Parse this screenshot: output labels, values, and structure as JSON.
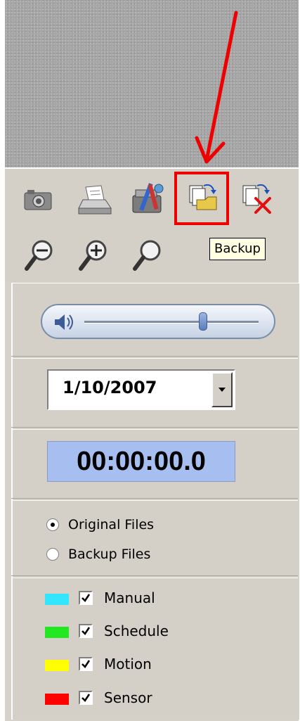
{
  "toolbar": {
    "row1": [
      {
        "name": "snapshot-camera-icon"
      },
      {
        "name": "print-icon"
      },
      {
        "name": "settings-tools-icon"
      },
      {
        "name": "backup-icon"
      },
      {
        "name": "delete-backup-icon"
      }
    ],
    "row2": [
      {
        "name": "zoom-out-icon"
      },
      {
        "name": "zoom-in-icon"
      },
      {
        "name": "zoom-reset-icon"
      }
    ],
    "tooltip": "Backup"
  },
  "playback": {
    "volume_level": 0.68,
    "date": "1/10/2007",
    "time": "00:00:00.0"
  },
  "source": {
    "options": [
      "Original Files",
      "Backup Files"
    ],
    "selected": "Original Files"
  },
  "legend": [
    {
      "label": "Manual",
      "color": "#33e6ff",
      "checked": true
    },
    {
      "label": "Schedule",
      "color": "#22e822",
      "checked": true
    },
    {
      "label": "Motion",
      "color": "#ffff00",
      "checked": true
    },
    {
      "label": "Sensor",
      "color": "#ff0000",
      "checked": true
    }
  ]
}
